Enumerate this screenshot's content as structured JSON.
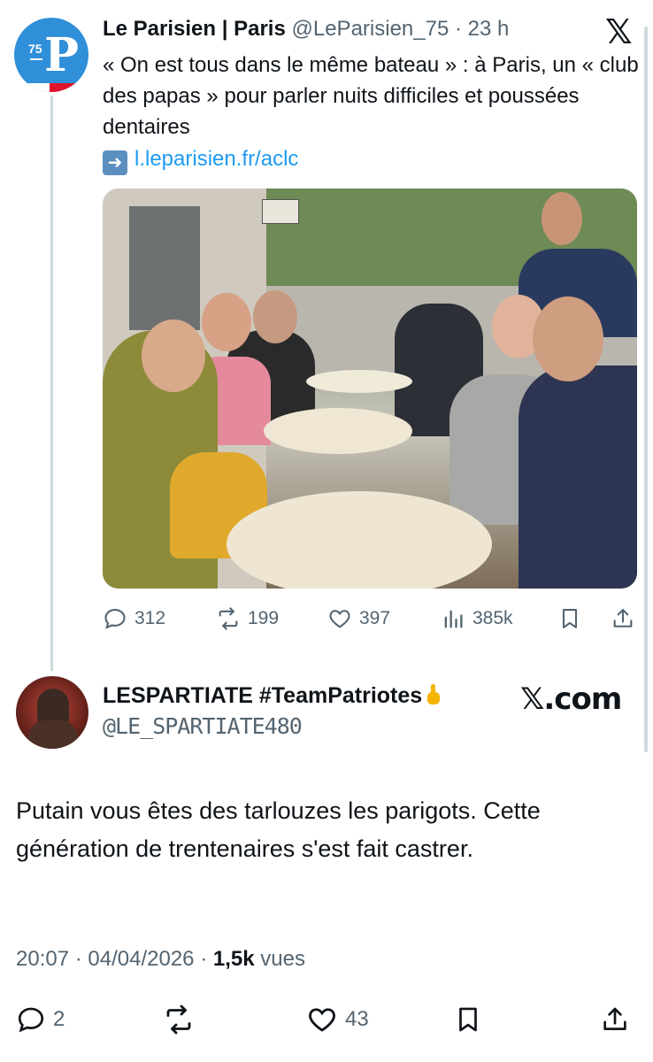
{
  "quoted_tweet": {
    "author_name": "Le Parisien | Paris",
    "handle": "@LeParisien_75",
    "separator": "·",
    "time": "23 h",
    "avatar_text": "75",
    "avatar_letter": "P",
    "text": "« On est tous dans le même bateau » : à Paris, un « club des papas » pour parler nuits difficiles et poussées dentaires",
    "link_arrow": "➡️",
    "link_text": "l.leparisien.fr/aclc",
    "brand_logo": "𝕏",
    "actions": {
      "replies": "312",
      "reposts": "199",
      "likes": "397",
      "views": "385k"
    }
  },
  "reply": {
    "author_name": "LESPARTIATE #TeamPatriotes",
    "name_emoji": "middle-finger-emoji",
    "handle": "@LE_SPARTIATE480",
    "watermark": "𝕏.com",
    "text": "Putain vous êtes des tarlouzes les parigots. Cette génération de trentenaires s'est fait castrer.",
    "time": "20:07",
    "date": "04/04/2026",
    "views_count": "1,5k",
    "views_label": "vues",
    "actions": {
      "replies": "2",
      "reposts": "",
      "likes": "43"
    }
  },
  "colors": {
    "text": "#0f1419",
    "muted": "#536471",
    "link": "#1d9bf0",
    "thread_line": "#cfd9de"
  }
}
